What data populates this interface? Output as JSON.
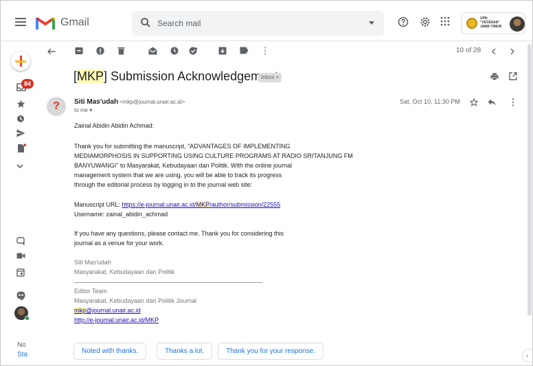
{
  "app": {
    "brand": "Gmail",
    "search_placeholder": "Search mail",
    "account_org": [
      "UPN",
      "\"VETERAN\"",
      "JAWA TIMUR"
    ]
  },
  "rail": {
    "unread_count": "84",
    "meet_label_1": "No",
    "meet_label_2": "Sta"
  },
  "toolbar": {
    "pager": "10 of 28"
  },
  "email": {
    "subject_prefix": "[",
    "subject_code": "MKP",
    "subject_rest": "] Submission Acknowledgement",
    "label": "Inbox ×",
    "sender_name": "Siti Mas'udah",
    "sender_email": "<mkp@journal.unair.ac.id>",
    "to": "to me ▾",
    "date": "Sat, Oct 10, 11:30 PM",
    "greeting": "Zainal Abidin Abidin Achmad:",
    "paragraph1": [
      "Thank you for submitting the manuscript, \"ADVANTAGES OF IMPLEMENTING",
      "MEDIAMORPHOSIS IN SUPPORTING USING CULTURE PROGRAMS AT RADIO SRITANJUNG FM",
      "BANYUWANGI\" to Masyarakat, Kebudayaan dan Politik. With the online journal",
      "management system that we are using, you will be able to track its progress",
      "through the editorial process by logging in to the journal web site:"
    ],
    "url_label": "Manuscript URL: ",
    "url_pre": "https://e-journal.unair.ac.id/",
    "url_hl": "MKP",
    "url_post": "/author/submission/22555",
    "username": "Username: zainal_abidin_achmad",
    "paragraph2": [
      "If you have any questions, please contact me. Thank you for considering this",
      "journal as a venue for your work."
    ],
    "sig_name": "Siti Mas'udah",
    "sig_journal": "Masyarakat, Kebudayaan dan Politik",
    "team": "Editor Team",
    "team_journal": "Masyarakat, Kebudayaan dan Politik Journal",
    "contact_hl": "mkp",
    "contact_rest": "@journal.unair.ac.id",
    "journal_url": "http://e-journal.unair.ac.id/MKP"
  },
  "smart_replies": [
    "Noted with thanks.",
    "Thanks a lot.",
    "Thank you for your response."
  ],
  "colors": {
    "accent": "#1a73e8",
    "badge": "#d93025",
    "highlight": "#fff8b3"
  }
}
